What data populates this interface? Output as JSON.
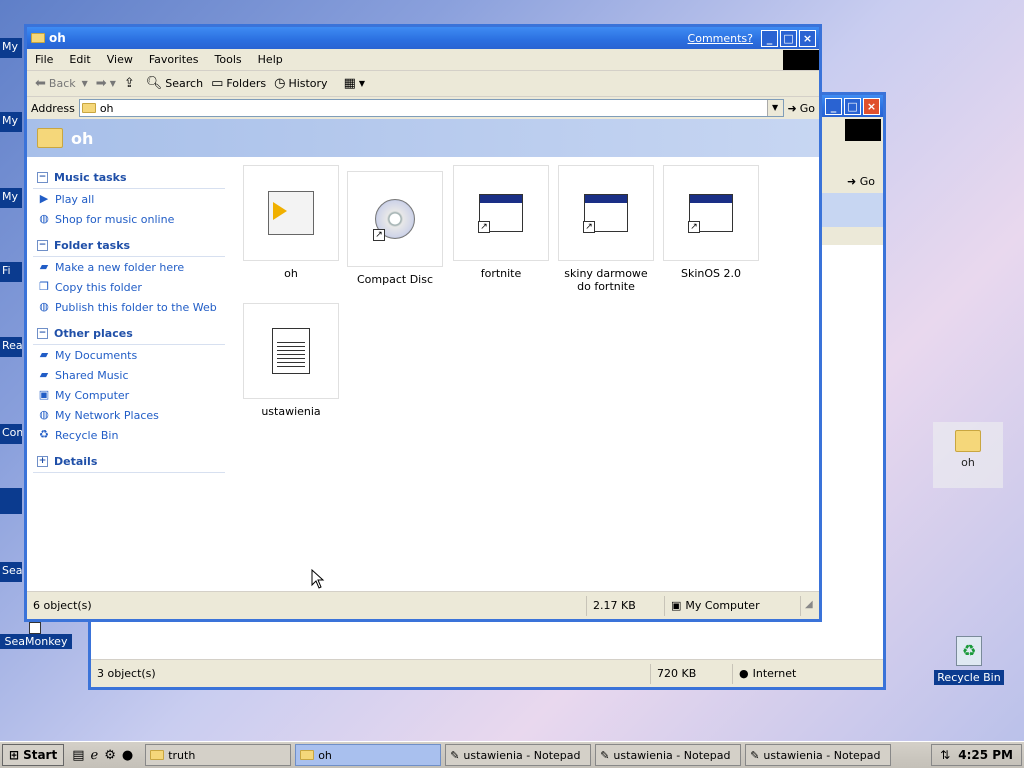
{
  "desktop": {
    "left_labels": [
      "My D",
      "My",
      "My",
      "Fi",
      "Rea",
      "Com",
      "Sea"
    ],
    "seamonkey_label": "SeaMonkey",
    "recycle_label": "Recycle Bin",
    "oh_folder_label": "oh"
  },
  "back_window": {
    "go_label": "Go",
    "status_objects": "3 object(s)",
    "status_size": "720 KB",
    "status_zone": "Internet"
  },
  "main_window": {
    "title": "oh",
    "comments_link": "Comments?",
    "menu": [
      "File",
      "Edit",
      "View",
      "Favorites",
      "Tools",
      "Help"
    ],
    "toolbar": {
      "back": "Back",
      "search": "Search",
      "folders": "Folders",
      "history": "History"
    },
    "address_label": "Address",
    "address_value": "oh",
    "go_label": "Go",
    "header_title": "oh",
    "sidebar": {
      "music_tasks": {
        "title": "Music tasks",
        "items": [
          "Play all",
          "Shop for music online"
        ]
      },
      "folder_tasks": {
        "title": "Folder tasks",
        "items": [
          "Make a new folder here",
          "Copy this folder",
          "Publish this folder to the Web"
        ]
      },
      "other_places": {
        "title": "Other places",
        "items": [
          "My Documents",
          "Shared Music",
          "My Computer",
          "My Network Places",
          "Recycle Bin"
        ]
      },
      "details": {
        "title": "Details"
      }
    },
    "files": [
      {
        "name": "oh",
        "icon": "media-file-icon"
      },
      {
        "name": "Compact Disc",
        "icon": "cd-shortcut-icon"
      },
      {
        "name": "fortnite",
        "icon": "app-shortcut-icon"
      },
      {
        "name": "skiny darmowe do fortnite",
        "icon": "app-shortcut-icon"
      },
      {
        "name": "SkinOS 2.0",
        "icon": "app-shortcut-icon"
      },
      {
        "name": "ustawienia",
        "icon": "notepad-icon"
      }
    ],
    "status": {
      "objects": "6 object(s)",
      "size": "2.17 KB",
      "location": "My Computer"
    }
  },
  "taskbar": {
    "start": "Start",
    "tasks": [
      "truth",
      "oh",
      "ustawienia - Notepad",
      "ustawienia - Notepad",
      "ustawienia - Notepad"
    ],
    "clock": "4:25 PM"
  }
}
